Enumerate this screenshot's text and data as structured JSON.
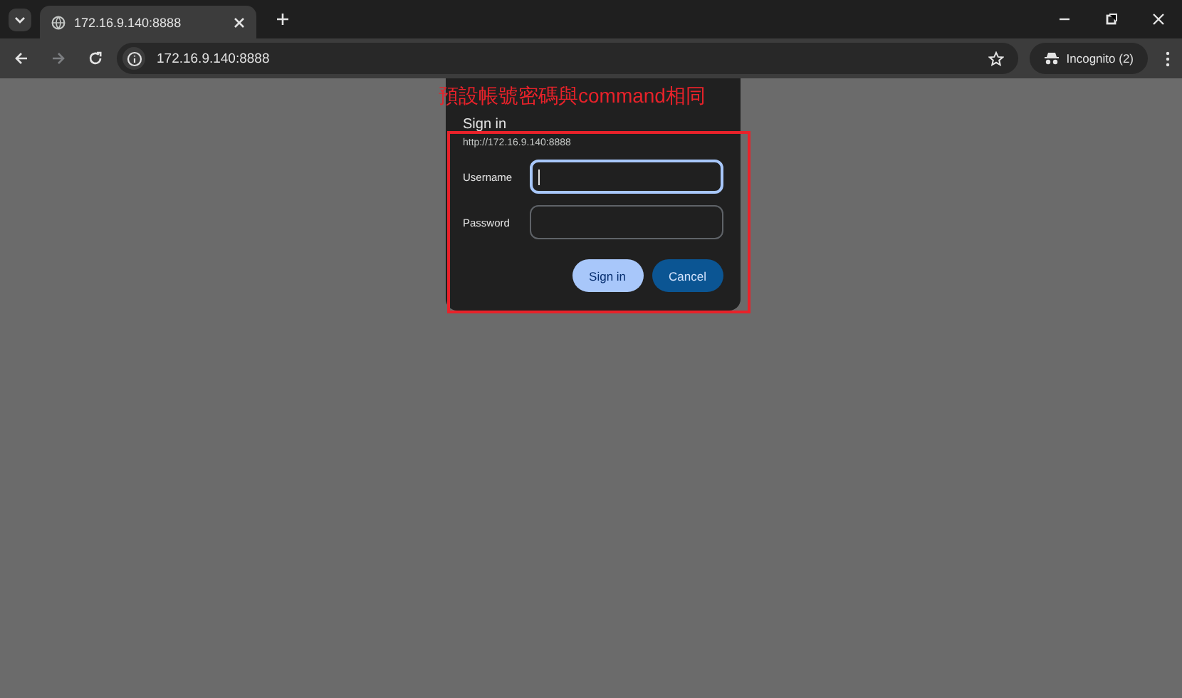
{
  "tabs": [
    {
      "title": "172.16.9.140:8888",
      "selected": true
    }
  ],
  "address_bar": {
    "url": "172.16.9.140:8888"
  },
  "profile": {
    "label": "Incognito (2)"
  },
  "dialog": {
    "title": "Sign in",
    "origin": "http://172.16.9.140:8888",
    "fields": [
      {
        "label": "Username",
        "focused": true
      },
      {
        "label": "Password",
        "focused": false
      }
    ],
    "buttons": [
      {
        "label": "Sign in",
        "kind": "primary"
      },
      {
        "label": "Cancel",
        "kind": "secondary"
      }
    ]
  },
  "annotation": {
    "text": "預設帳號密碼與command相同"
  }
}
